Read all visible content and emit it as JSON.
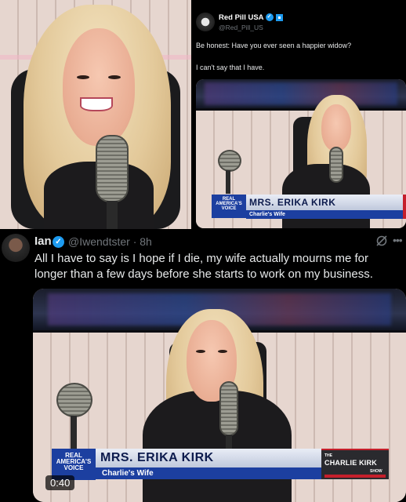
{
  "panel_top_left": {
    "description_icon": "person-laughing-at-microphone"
  },
  "tweet_top": {
    "author_name": "Red Pill USA",
    "author_handle": "@Red_Pill_US",
    "verified_mark": "✓",
    "line1": "Be honest: Have you ever seen a happier widow?",
    "line2": "I can't say that I have.",
    "lower_third": {
      "logo_line1": "REAL",
      "logo_line2": "AMERICA'S",
      "logo_line3": "VOICE",
      "name": "MRS. ERIKA KIRK",
      "subtitle": "Charlie's Wife"
    }
  },
  "tweet_main": {
    "author_name": "Ian",
    "author_handle": "@Iwendtster · 8h",
    "verified_mark": "✓",
    "more_label": "•••",
    "text": "All I have to say is I hope if I die, my wife actually mourns me for longer than a few days before she starts to work on my business.",
    "video": {
      "duration": "0:40",
      "lower_third": {
        "logo_line1": "REAL",
        "logo_line2": "AMERICA'S",
        "logo_line3": "VOICE",
        "name": "MRS. ERIKA KIRK",
        "subtitle": "Charlie's Wife",
        "show_the": "THE",
        "show_name": "CHARLIE KIRK",
        "show_suffix": "SHOW"
      }
    }
  },
  "colors": {
    "background": "#000000",
    "text_primary": "#e7e9ea",
    "text_secondary": "#71767b",
    "verified_blue": "#1d9bf0",
    "ticker_blue": "#1c3fa0",
    "ticker_red": "#c51f2b"
  }
}
